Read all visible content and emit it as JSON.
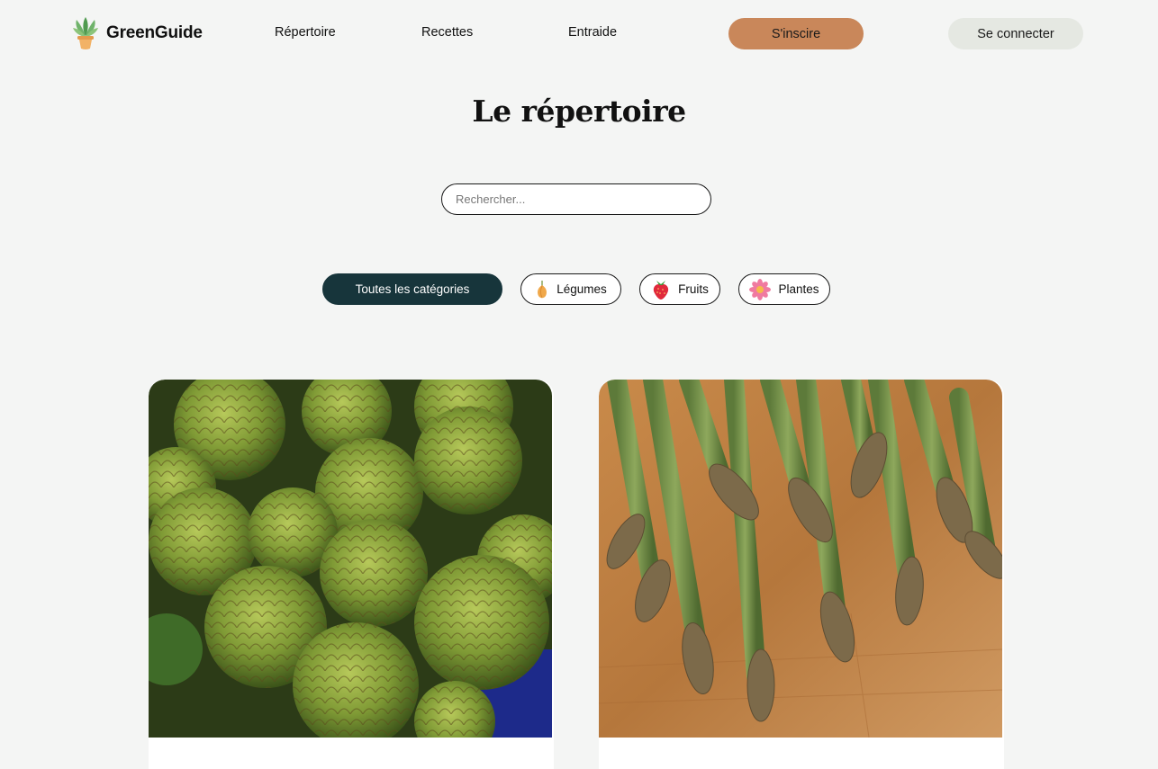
{
  "header": {
    "brand": "GreenGuide",
    "logo_icon": "potted-plant-icon",
    "nav": [
      {
        "label": "Répertoire"
      },
      {
        "label": "Recettes"
      },
      {
        "label": "Entraide"
      }
    ],
    "signup_label": "S'inscire",
    "login_label": "Se connecter"
  },
  "main": {
    "title": "Le répertoire",
    "search": {
      "placeholder": "Rechercher...",
      "value": ""
    },
    "categories": [
      {
        "label": "Toutes les catégories",
        "icon": null,
        "selected": true
      },
      {
        "label": "Légumes",
        "icon": "onion-icon",
        "selected": false
      },
      {
        "label": "Fruits",
        "icon": "strawberry-icon",
        "selected": false
      },
      {
        "label": "Plantes",
        "icon": "flower-icon",
        "selected": false
      }
    ],
    "cards": [
      {
        "image": "artichokes-photo"
      },
      {
        "image": "asparagus-photo"
      }
    ]
  },
  "colors": {
    "background": "#f4f5f4",
    "signup_button": "#c9875a",
    "login_button": "#e5e8e2",
    "selected_chip": "#17353b"
  }
}
